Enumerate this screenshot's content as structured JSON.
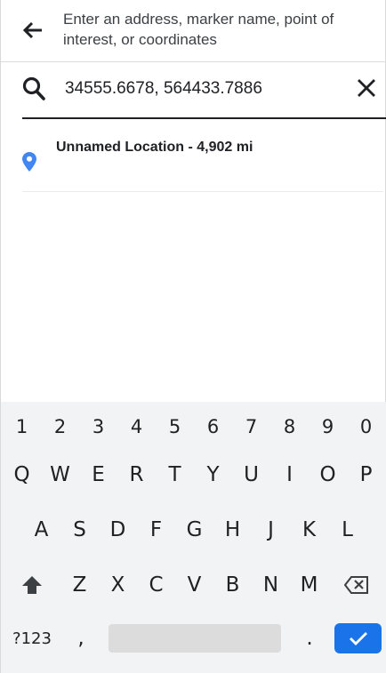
{
  "header": {
    "hint": "Enter an address, marker name, point of interest, or coordinates",
    "back_icon": "arrow-back-icon"
  },
  "search": {
    "value": "34555.6678, 564433.7886",
    "search_icon": "search-icon",
    "clear_icon": "close-icon"
  },
  "results": [
    {
      "label": "Unnamed Location - 4,902 mi",
      "icon": "location-pin-icon",
      "icon_color": "#4285f4"
    }
  ],
  "keyboard": {
    "number_row": [
      "1",
      "2",
      "3",
      "4",
      "5",
      "6",
      "7",
      "8",
      "9",
      "0"
    ],
    "row1": [
      "Q",
      "W",
      "E",
      "R",
      "T",
      "Y",
      "U",
      "I",
      "O",
      "P"
    ],
    "row2": [
      "A",
      "S",
      "D",
      "F",
      "G",
      "H",
      "J",
      "K",
      "L"
    ],
    "row3": [
      "Z",
      "X",
      "C",
      "V",
      "B",
      "N",
      "M"
    ],
    "symbols_key": "?123",
    "comma_key": ",",
    "period_key": ".",
    "shift_icon": "shift-icon",
    "backspace_icon": "backspace-icon",
    "enter_icon": "check-icon",
    "accent_color": "#1a73e8"
  }
}
